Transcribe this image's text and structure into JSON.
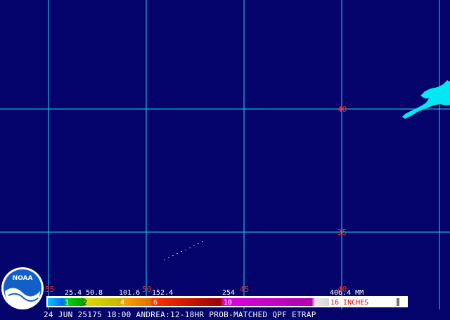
{
  "map": {
    "background_color": "#03036b",
    "grid_color": "#20d8e8",
    "label_color": "#ff2a2a",
    "lat_labels": [
      "40",
      "35"
    ],
    "lon_labels": [
      "55",
      "50",
      "45",
      "40"
    ],
    "precip_color": "#00e8f0"
  },
  "legend": {
    "mm_values": [
      "25.4",
      "50.8",
      "101.6",
      "152.4",
      "254",
      "406.4"
    ],
    "mm_unit": "MM",
    "inch_values": [
      "1",
      "2",
      "4",
      "6",
      "10",
      "16"
    ],
    "inch_unit": "INCHES",
    "inch_readout": "16 INCHES",
    "mm_readout": "406.4 MM"
  },
  "logo": {
    "text": "NOAA"
  },
  "caption": {
    "text": "24 JUN 25175 18:00 ANDREA:12-18HR PROB-MATCHED QPF ETRAP"
  }
}
